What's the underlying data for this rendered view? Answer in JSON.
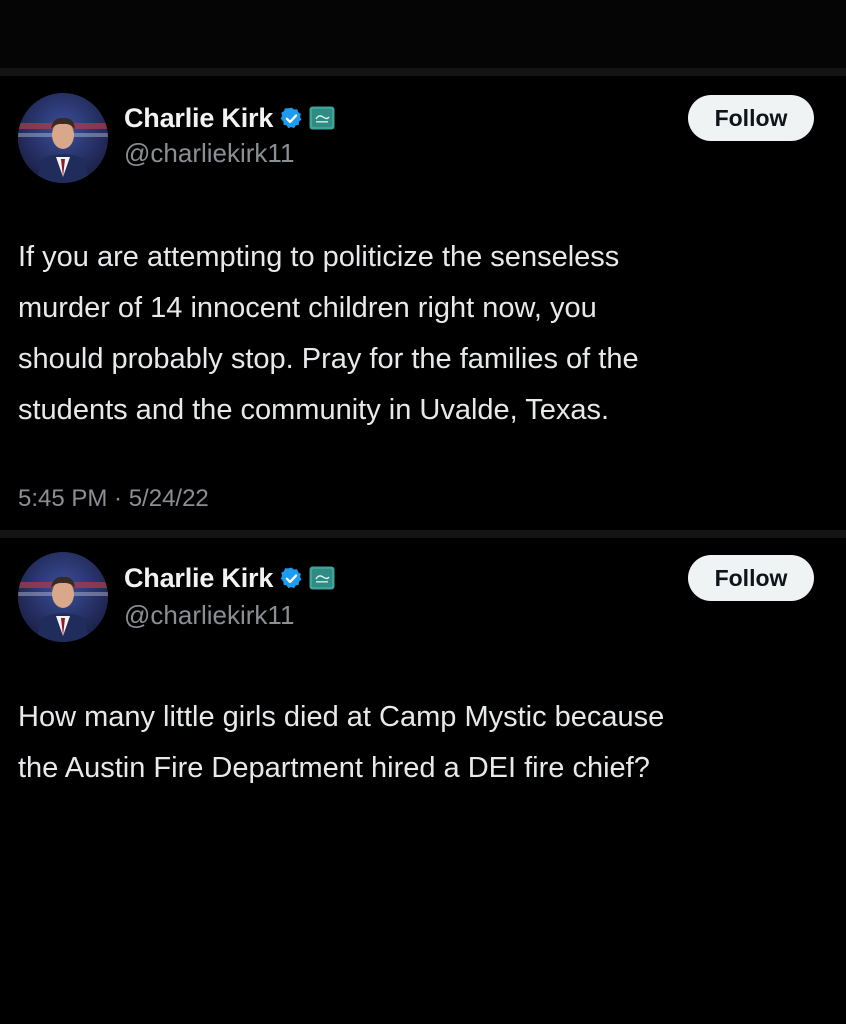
{
  "colors": {
    "background": "#000000",
    "verified": "#1d9bf0",
    "affiliate_badge": "#3fa39a",
    "follow_button_bg": "#eff3f4"
  },
  "tweets": [
    {
      "author": {
        "display_name": "Charlie Kirk",
        "handle": "@charliekirk11",
        "avatar": "profile-photo",
        "verified_icon": "verified-badge-icon",
        "affiliate_icon": "affiliate-badge-icon"
      },
      "follow_label": "Follow",
      "text_lines": [
        "If you are attempting to politicize the senseless",
        "murder of 14 innocent children right now, you",
        "should probably stop. Pray for the families of the",
        "students and the community in Uvalde, Texas."
      ],
      "timestamp": "5:45 PM · 5/24/22"
    },
    {
      "author": {
        "display_name": "Charlie Kirk",
        "handle": "@charliekirk11",
        "avatar": "profile-photo",
        "verified_icon": "verified-badge-icon",
        "affiliate_icon": "affiliate-badge-icon"
      },
      "follow_label": "Follow",
      "text_lines": [
        "How many little girls died at Camp Mystic because",
        "the Austin Fire Department hired a DEI fire chief?"
      ]
    }
  ]
}
